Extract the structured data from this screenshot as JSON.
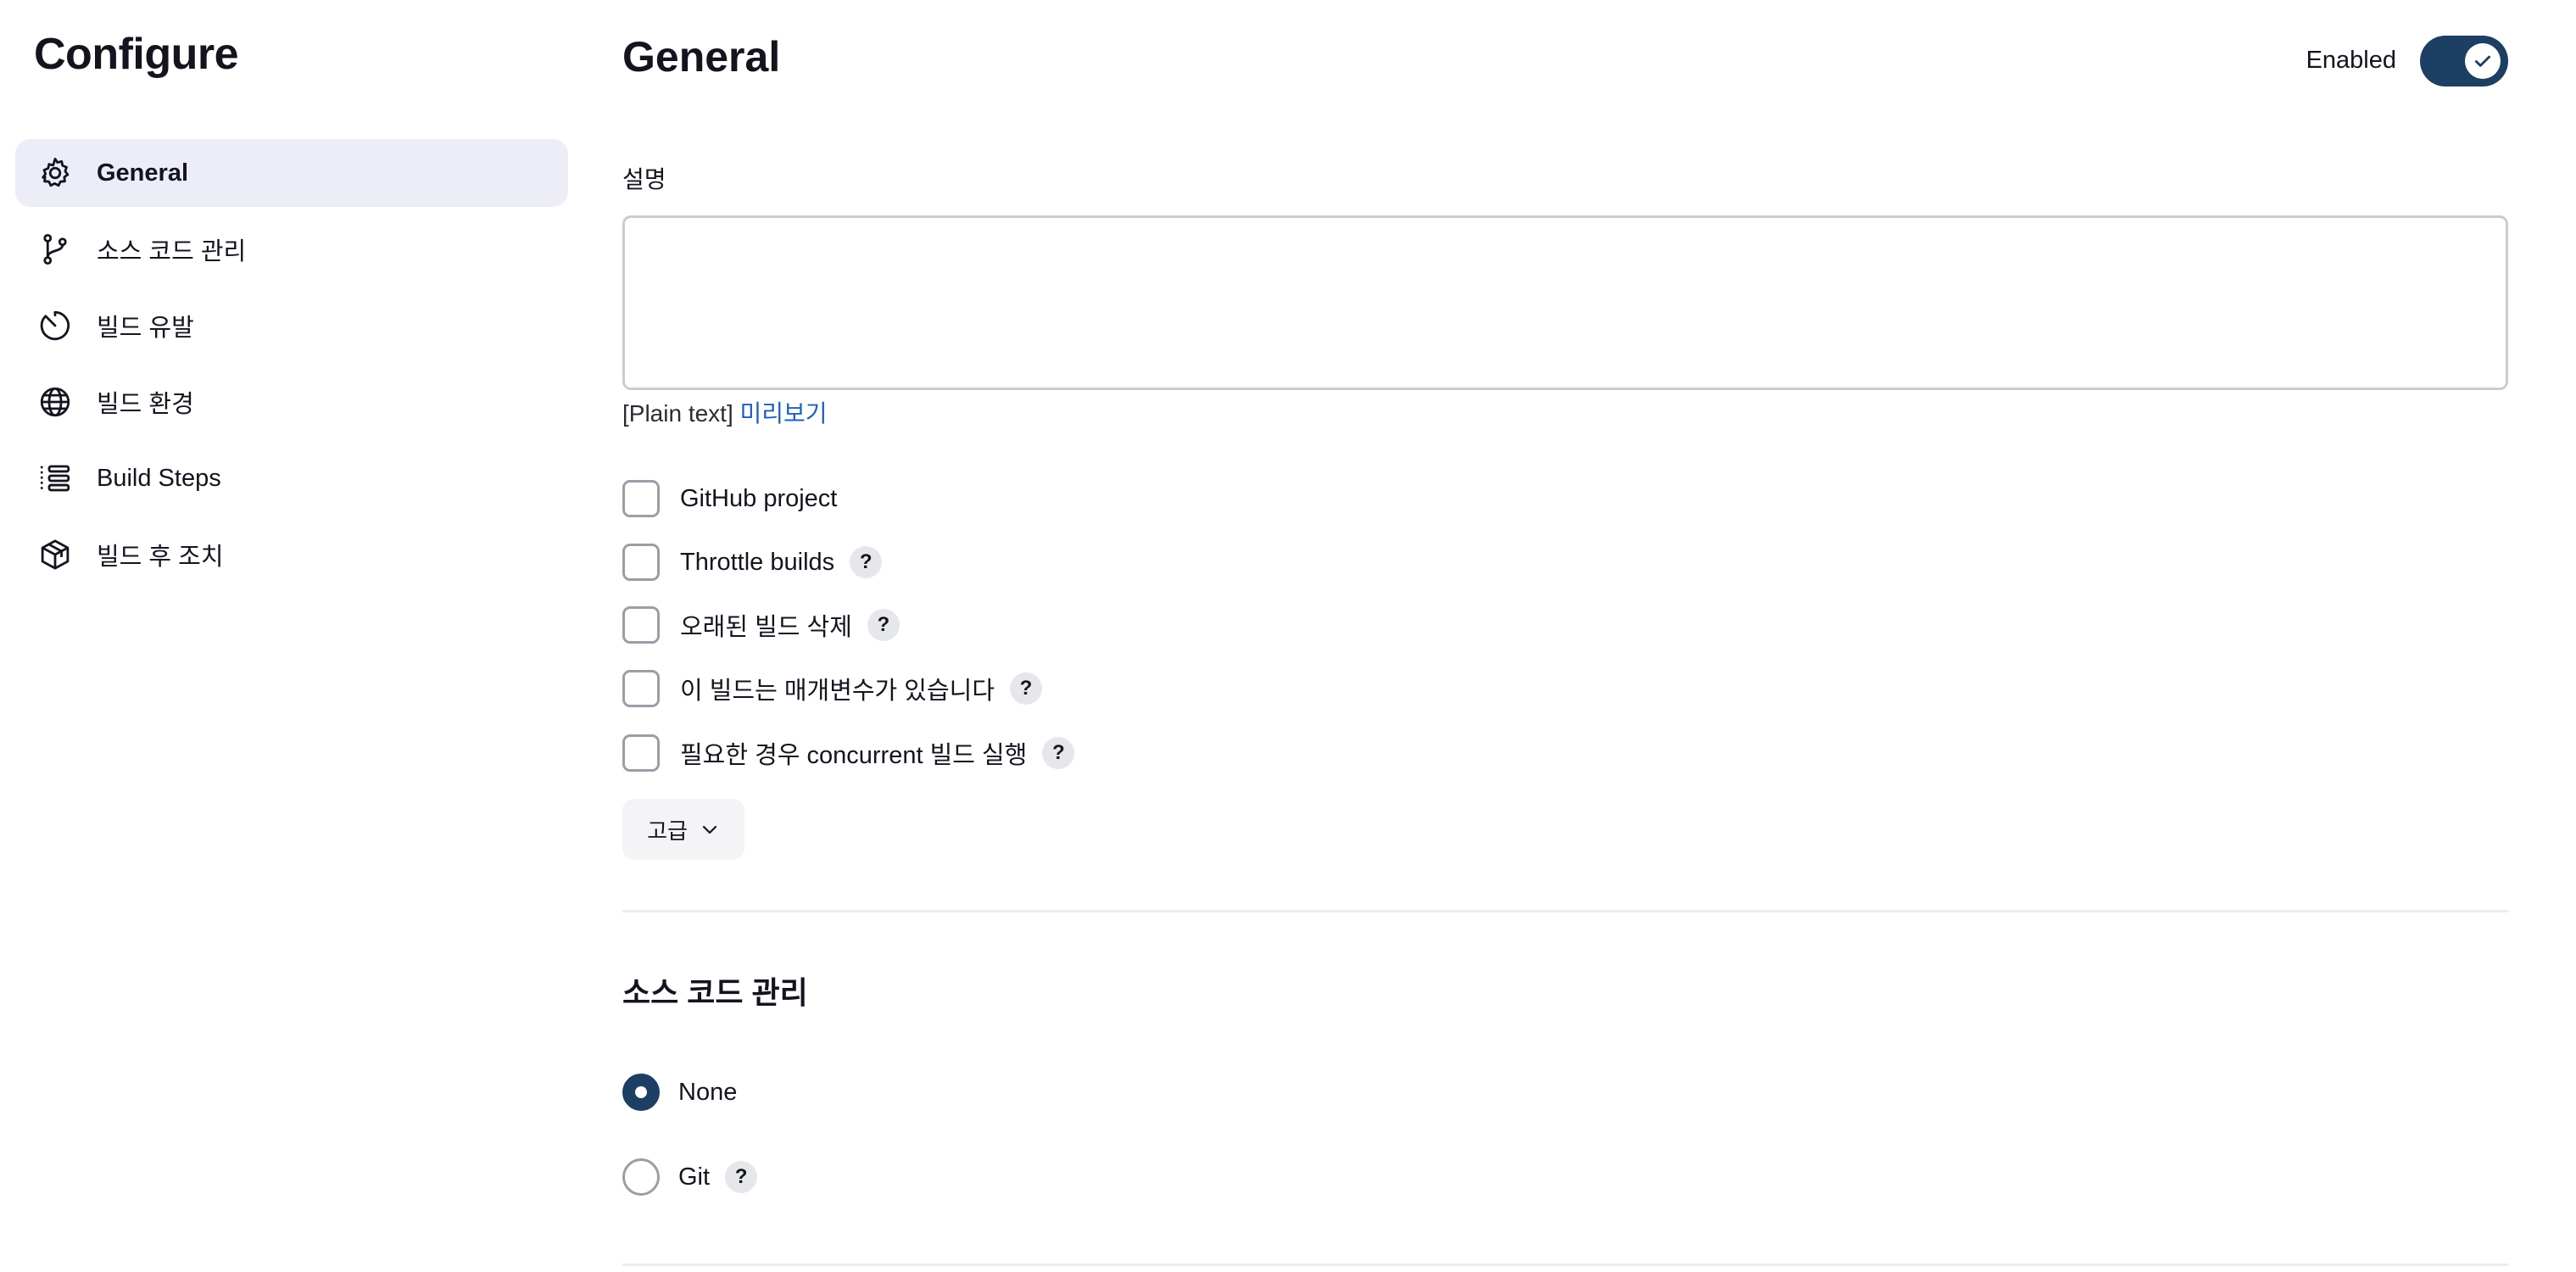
{
  "page_title": "Configure",
  "sidebar": {
    "items": [
      {
        "label": "General",
        "icon": "gear-icon",
        "active": true
      },
      {
        "label": "소스 코드 관리",
        "icon": "branch-icon"
      },
      {
        "label": "빌드 유발",
        "icon": "clock-icon"
      },
      {
        "label": "빌드 환경",
        "icon": "globe-icon"
      },
      {
        "label": "Build Steps",
        "icon": "list-icon"
      },
      {
        "label": "빌드 후 조치",
        "icon": "package-icon"
      }
    ]
  },
  "general": {
    "title": "General",
    "enabled_label": "Enabled",
    "enabled": true,
    "description_label": "설명",
    "description_value": "",
    "format_prefix": "[Plain text]",
    "preview_link": "미리보기",
    "options": [
      {
        "label": "GitHub project",
        "checked": false,
        "help": false
      },
      {
        "label": "Throttle builds",
        "checked": false,
        "help": true
      },
      {
        "label": "오래된 빌드 삭제",
        "checked": false,
        "help": true
      },
      {
        "label": "이 빌드는 매개변수가 있습니다",
        "checked": false,
        "help": true
      },
      {
        "label": "필요한 경우 concurrent 빌드 실행",
        "checked": false,
        "help": true
      }
    ],
    "help_glyph": "?",
    "advanced_label": "고급"
  },
  "scm": {
    "title": "소스 코드 관리",
    "options": [
      {
        "label": "None",
        "selected": true
      },
      {
        "label": "Git",
        "selected": false,
        "help": true
      }
    ]
  },
  "colors": {
    "accent": "#1c3f63",
    "link": "#1f5fbf",
    "active_bg": "#ecedf6"
  }
}
